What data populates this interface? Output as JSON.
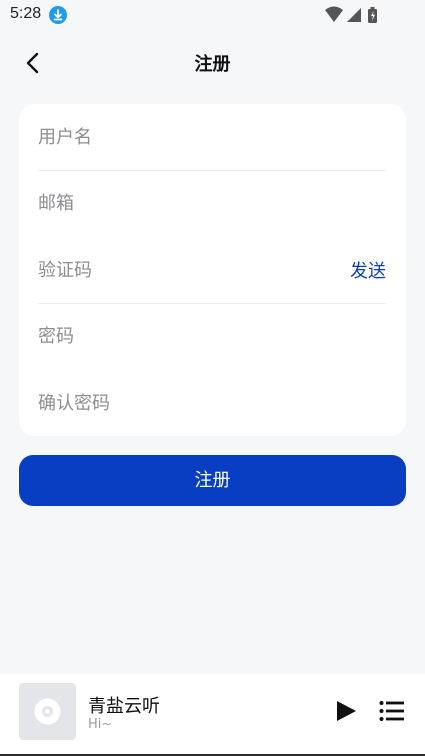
{
  "status_bar": {
    "time": "5:28",
    "icons": [
      "download-icon",
      "wifi-icon",
      "signal-icon",
      "battery-icon"
    ]
  },
  "header": {
    "title": "注册",
    "back_icon": "chevron-left-icon"
  },
  "form": {
    "username": {
      "placeholder": "用户名",
      "value": ""
    },
    "email": {
      "placeholder": "邮箱",
      "value": ""
    },
    "code": {
      "placeholder": "验证码",
      "value": "",
      "send_label": "发送"
    },
    "password": {
      "placeholder": "密码",
      "value": ""
    },
    "confirm_password": {
      "placeholder": "确认密码",
      "value": ""
    }
  },
  "register_button": {
    "label": "注册"
  },
  "player": {
    "title": "青盐云听",
    "subtitle": "Hi~",
    "icons": [
      "album-disc-icon",
      "play-icon",
      "playlist-icon"
    ]
  },
  "colors": {
    "accent": "#0a3ec2",
    "background": "#f6f7f9",
    "card": "#ffffff",
    "placeholder": "#8d8d92",
    "download_badge": "#1e9bf0"
  }
}
